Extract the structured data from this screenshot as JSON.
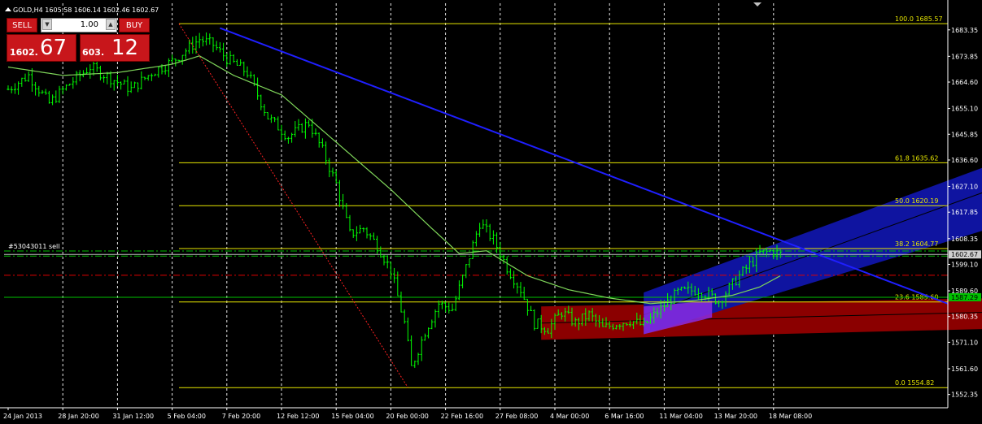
{
  "chart_title": "GOLD,H4  1605.58 1606.14 1602.46 1602.67",
  "trade_panel": {
    "sell_label": "SELL",
    "buy_label": "BUY",
    "lot_value": "1.00",
    "sell_price_small": "1602.",
    "sell_price_big": "67",
    "buy_price_small": "603.",
    "buy_price_big": "12"
  },
  "chart_data": {
    "type": "line",
    "symbol": "GOLD",
    "timeframe": "H4",
    "ohlc": {
      "open": 1605.58,
      "high": 1606.14,
      "low": 1602.46,
      "close": 1602.67
    },
    "ylim": [
      1550.0,
      1690.0
    ],
    "y_ticks": [
      "1683.35",
      "1673.85",
      "1664.60",
      "1655.10",
      "1645.85",
      "1636.60",
      "1627.10",
      "1617.85",
      "1608.35",
      "1599.10",
      "1589.60",
      "1580.35",
      "1571.10",
      "1561.60",
      "1552.35"
    ],
    "y_tick_values": [
      1683.35,
      1673.85,
      1664.6,
      1655.1,
      1645.85,
      1636.6,
      1627.1,
      1617.85,
      1608.35,
      1599.1,
      1589.6,
      1580.35,
      1571.1,
      1561.6,
      1552.35
    ],
    "x_ticks": [
      "24 Jan 2013",
      "28 Jan 20:00",
      "31 Jan 12:00",
      "5 Feb 04:00",
      "7 Feb 20:00",
      "12 Feb 12:00",
      "15 Feb 04:00",
      "20 Feb 00:00",
      "22 Feb 16:00",
      "27 Feb 08:00",
      "4 Mar 00:00",
      "6 Mar 16:00",
      "11 Mar 04:00",
      "13 Mar 20:00",
      "18 Mar 08:00"
    ],
    "x_count": 330,
    "x_tick_bars": [
      0,
      16,
      32,
      48,
      64,
      80,
      96,
      112,
      128,
      144,
      160,
      176,
      192,
      208,
      224
    ],
    "close_keyframes": [
      [
        0,
        1662
      ],
      [
        6,
        1667
      ],
      [
        12,
        1657
      ],
      [
        18,
        1664
      ],
      [
        24,
        1670
      ],
      [
        30,
        1666
      ],
      [
        36,
        1662
      ],
      [
        42,
        1668
      ],
      [
        48,
        1672
      ],
      [
        52,
        1676
      ],
      [
        56,
        1680
      ],
      [
        60,
        1678
      ],
      [
        64,
        1673
      ],
      [
        70,
        1668
      ],
      [
        76,
        1652
      ],
      [
        82,
        1645
      ],
      [
        88,
        1650
      ],
      [
        92,
        1640
      ],
      [
        96,
        1628
      ],
      [
        100,
        1610
      ],
      [
        104,
        1612
      ],
      [
        108,
        1606
      ],
      [
        112,
        1597
      ],
      [
        116,
        1578
      ],
      [
        118,
        1562
      ],
      [
        122,
        1575
      ],
      [
        126,
        1585
      ],
      [
        130,
        1583
      ],
      [
        134,
        1598
      ],
      [
        138,
        1614
      ],
      [
        142,
        1608
      ],
      [
        146,
        1598
      ],
      [
        150,
        1590
      ],
      [
        154,
        1578
      ],
      [
        158,
        1576
      ],
      [
        162,
        1582
      ],
      [
        166,
        1578
      ],
      [
        170,
        1581
      ],
      [
        174,
        1576
      ],
      [
        178,
        1578
      ],
      [
        182,
        1579
      ],
      [
        186,
        1577
      ],
      [
        190,
        1582
      ],
      [
        196,
        1589
      ],
      [
        202,
        1590
      ],
      [
        208,
        1586
      ],
      [
        214,
        1595
      ],
      [
        220,
        1603
      ],
      [
        224,
        1604
      ],
      [
        226,
        1602.67
      ]
    ],
    "moving_average_keyframes": [
      [
        0,
        1670
      ],
      [
        16,
        1667
      ],
      [
        32,
        1668
      ],
      [
        48,
        1671
      ],
      [
        56,
        1674
      ],
      [
        66,
        1667
      ],
      [
        80,
        1660
      ],
      [
        96,
        1643
      ],
      [
        112,
        1626
      ],
      [
        124,
        1612
      ],
      [
        132,
        1603
      ],
      [
        140,
        1604
      ],
      [
        152,
        1595
      ],
      [
        164,
        1590
      ],
      [
        176,
        1587
      ],
      [
        188,
        1585
      ],
      [
        200,
        1586
      ],
      [
        212,
        1588
      ],
      [
        220,
        1591
      ],
      [
        226,
        1595
      ]
    ],
    "trendline": {
      "from": [
        62,
        1684
      ],
      "to": [
        290,
        1578
      ]
    },
    "dashed_swing_line": {
      "from": [
        50,
        1685.57
      ],
      "to": [
        117,
        1554.82
      ]
    },
    "fibonacci": [
      {
        "level": "100.0",
        "price": 1685.57
      },
      {
        "level": "61.8",
        "price": 1635.62
      },
      {
        "level": "50.0",
        "price": 1620.19
      },
      {
        "level": "38.2",
        "price": 1604.77
      },
      {
        "level": "23.6",
        "price": 1585.6
      },
      {
        "level": "0.0",
        "price": 1554.82
      }
    ],
    "fibonacci_from_bar": 50,
    "blue_channel": {
      "x0": 186,
      "x1": 290,
      "lower0": 1574,
      "lower1": 1613,
      "upper0": 1589,
      "upper1": 1636,
      "mid0": 1581,
      "mid1": 1627
    },
    "red_channel": {
      "x0": 156,
      "x1": 290,
      "lower0": 1572,
      "lower1": 1576,
      "upper0": 1584,
      "upper1": 1587,
      "mid0": 1578,
      "mid1": 1582
    },
    "purple_overlap": {
      "x0": 186,
      "x1": 206,
      "low0": 1574,
      "low1": 1580,
      "high0": 1584,
      "high1": 1586
    },
    "horizontal_levels": [
      {
        "name": "bid",
        "price": 1602.67,
        "label": "1602.67",
        "color": "#c0c0c0",
        "style": "solid"
      },
      {
        "name": "order",
        "price": 1603.9,
        "label": "#53043011 sell",
        "color": "#00c000",
        "style": "dashdot"
      },
      {
        "name": "order2",
        "price": 1602.1,
        "color": "#00c000",
        "style": "dashdot"
      },
      {
        "name": "stop",
        "price": 1595.2,
        "color": "#e00000",
        "style": "dashdot"
      },
      {
        "name": "green",
        "price": 1587.29,
        "label": "1587.29",
        "color": "#00c000",
        "style": "solid"
      }
    ],
    "colors": {
      "background": "#000000",
      "candles": "#00ff00",
      "moving_average": "#7fd65a",
      "trendline": "#1f1fff",
      "fib": "#e8e800",
      "blue_channel": "#0f14a0",
      "red_channel": "#8b0000",
      "purple": "#8a2be2",
      "grid": "#ffffff"
    }
  }
}
